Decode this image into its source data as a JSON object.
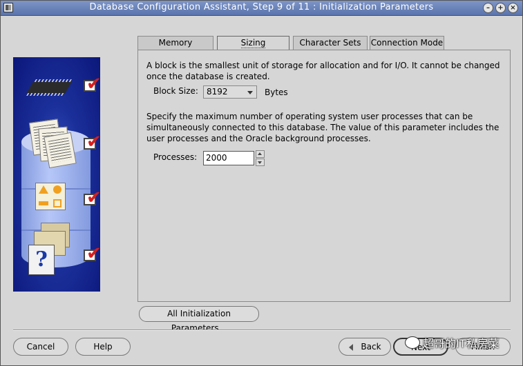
{
  "window": {
    "title": "Database Configuration Assistant, Step 9 of 11 : Initialization Parameters",
    "controls": [
      "minimize-icon",
      "maximize-icon",
      "close-icon"
    ]
  },
  "tabs": [
    {
      "label": "Memory",
      "active": false
    },
    {
      "label": "Sizing",
      "active": true
    },
    {
      "label": "Character Sets",
      "active": false
    },
    {
      "label": "Connection Mode",
      "active": false
    }
  ],
  "sizing": {
    "block_desc": "A block is the smallest unit of storage for allocation and for I/O. It cannot be changed once the database is created.",
    "block_size_label": "Block Size:",
    "block_size_value": "8192",
    "block_size_unit": "Bytes",
    "processes_desc": "Specify the maximum number of operating system user processes that can be simultaneously connected to this database. The value of this parameter includes the user processes and the Oracle background processes.",
    "processes_label": "Processes:",
    "processes_value": "2000"
  },
  "buttons": {
    "all_params": "All Initialization Parameters...",
    "cancel": "Cancel",
    "help": "Help",
    "back": "Back",
    "next": "Next",
    "finish": "Finish"
  },
  "watermark": "超哥的IT私房菜",
  "colors": {
    "titlebar": "#6b84bb",
    "graphic_bg": "#1b2f9a",
    "check_red": "#d81d1d"
  }
}
